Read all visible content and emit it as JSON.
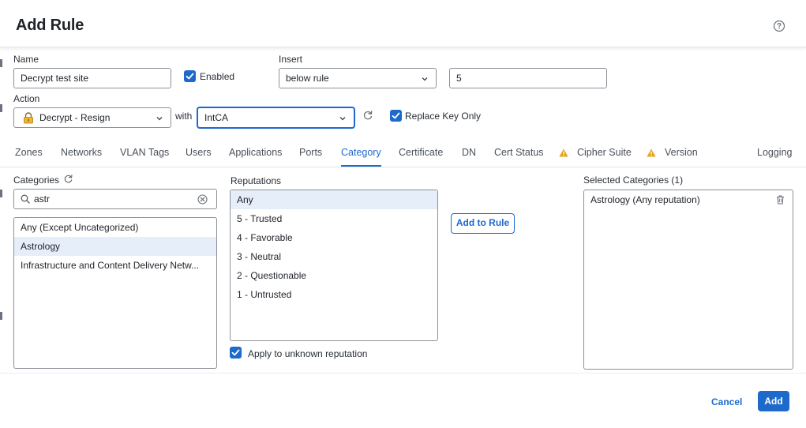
{
  "header": {
    "title": "Add Rule",
    "help_icon": "help-circle-icon"
  },
  "name": {
    "label": "Name",
    "value": "Decrypt test site"
  },
  "enabled": {
    "label": "Enabled",
    "checked": true
  },
  "insert": {
    "label": "Insert",
    "selected": "below rule",
    "position_value": "5"
  },
  "action": {
    "label": "Action",
    "selected": "Decrypt - Resign",
    "icon": "lock-icon"
  },
  "with": {
    "label": "with",
    "selected": "IntCA"
  },
  "replace_key_only": {
    "label": "Replace Key Only",
    "checked": true
  },
  "tabs": [
    {
      "label": "Zones"
    },
    {
      "label": "Networks"
    },
    {
      "label": "VLAN Tags"
    },
    {
      "label": "Users"
    },
    {
      "label": "Applications"
    },
    {
      "label": "Ports"
    },
    {
      "label": "Category",
      "active": true
    },
    {
      "label": "Certificate"
    },
    {
      "label": "DN"
    },
    {
      "label": "Cert Status"
    },
    {
      "label": "Cipher Suite",
      "warning": true
    },
    {
      "label": "Version",
      "warning": true
    },
    {
      "label": "Logging"
    }
  ],
  "categories": {
    "label": "Categories",
    "search_value": "astr",
    "items": [
      {
        "label": "Any (Except Uncategorized)"
      },
      {
        "label": "Astrology",
        "selected": true
      },
      {
        "label": "Infrastructure and Content Delivery Netw..."
      }
    ]
  },
  "reputations": {
    "label": "Reputations",
    "items": [
      {
        "label": "Any",
        "selected": true
      },
      {
        "label": "5 - Trusted"
      },
      {
        "label": "4 - Favorable"
      },
      {
        "label": "3 - Neutral"
      },
      {
        "label": "2 - Questionable"
      },
      {
        "label": "1 - Untrusted"
      }
    ],
    "apply_unknown_label": "Apply to unknown reputation",
    "apply_unknown_checked": true
  },
  "add_to_rule_label": "Add to Rule",
  "selected_categories": {
    "label": "Selected Categories (1)",
    "items": [
      {
        "label": "Astrology (Any reputation)"
      }
    ]
  },
  "footer": {
    "cancel_label": "Cancel",
    "add_label": "Add"
  },
  "colors": {
    "accent": "#1d69cc",
    "warning": "#e8a317",
    "selected_row": "#e6eef9"
  }
}
